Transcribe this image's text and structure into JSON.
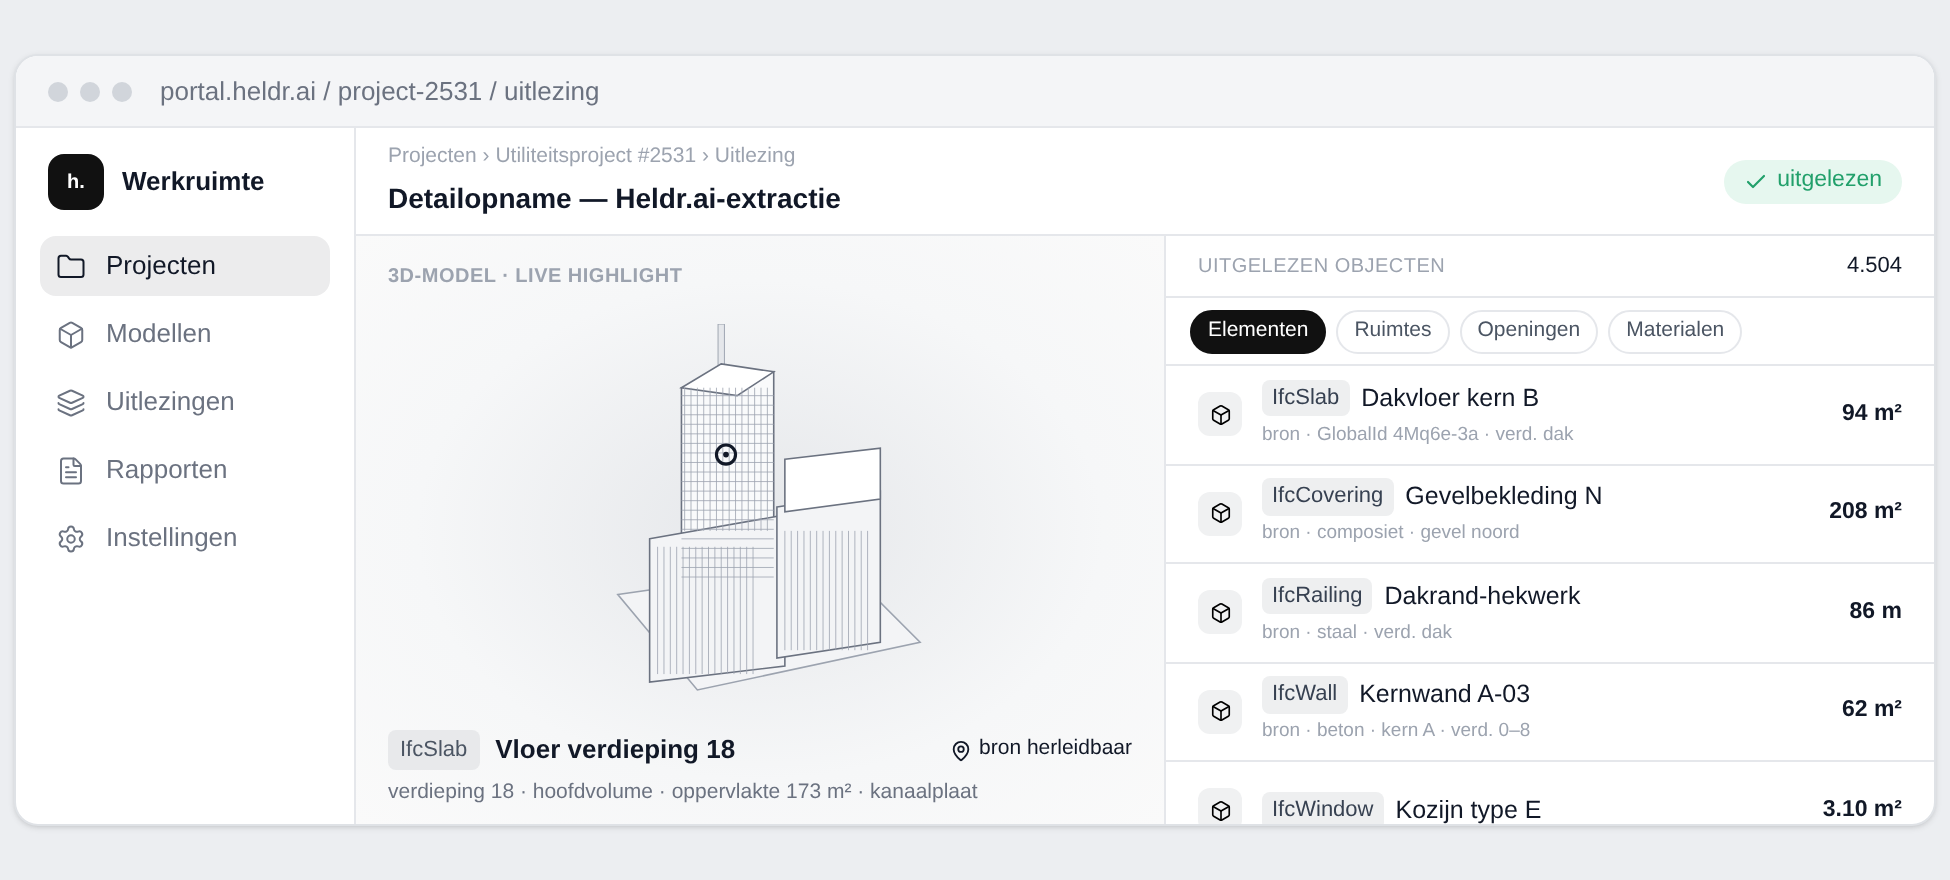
{
  "window": {
    "url": "portal.heldr.ai / project-2531 / uitlezing"
  },
  "sidebar": {
    "logo": "h.",
    "workspace": "Werkruimte",
    "items": [
      {
        "label": "Projecten",
        "selected": true
      },
      {
        "label": "Modellen",
        "selected": false
      },
      {
        "label": "Uitlezingen",
        "selected": false
      },
      {
        "label": "Rapporten",
        "selected": false
      },
      {
        "label": "Instellingen",
        "selected": false
      }
    ]
  },
  "header": {
    "breadcrumb": "Projecten › Utiliteitsproject #2531 › Uitlezing",
    "title": "Detailopname — Heldr.ai-extractie",
    "status": "uitgelezen"
  },
  "viewer": {
    "label": "3D-MODEL · LIVE HIGHLIGHT",
    "selection": {
      "type": "IfcSlab",
      "name": "Vloer verdieping 18",
      "source": "bron herleidbaar",
      "details": "verdieping 18 · hoofdvolume · oppervlakte 173 m² · kanaalplaat"
    }
  },
  "objects": {
    "heading": "UITGELEZEN OBJECTEN",
    "count": "4.504",
    "tabs": [
      {
        "label": "Elementen",
        "selected": true
      },
      {
        "label": "Ruimtes",
        "selected": false
      },
      {
        "label": "Openingen",
        "selected": false
      },
      {
        "label": "Materialen",
        "selected": false
      }
    ],
    "rows": [
      {
        "type": "IfcSlab",
        "name": "Dakvloer kern B",
        "meta": "bron · GlobalId 4Mq6e-3a · verd. dak",
        "value": "94 m²"
      },
      {
        "type": "IfcCovering",
        "name": "Gevelbekleding N",
        "meta": "bron · composiet · gevel noord",
        "value": "208 m²"
      },
      {
        "type": "IfcRailing",
        "name": "Dakrand-hekwerk",
        "meta": "bron · staal · verd. dak",
        "value": "86 m"
      },
      {
        "type": "IfcWall",
        "name": "Kernwand A-03",
        "meta": "bron · beton · kern A · verd. 0–8",
        "value": "62 m²"
      },
      {
        "type": "IfcWindow",
        "name": "Kozijn type E",
        "value": "3.10 m²"
      }
    ]
  }
}
